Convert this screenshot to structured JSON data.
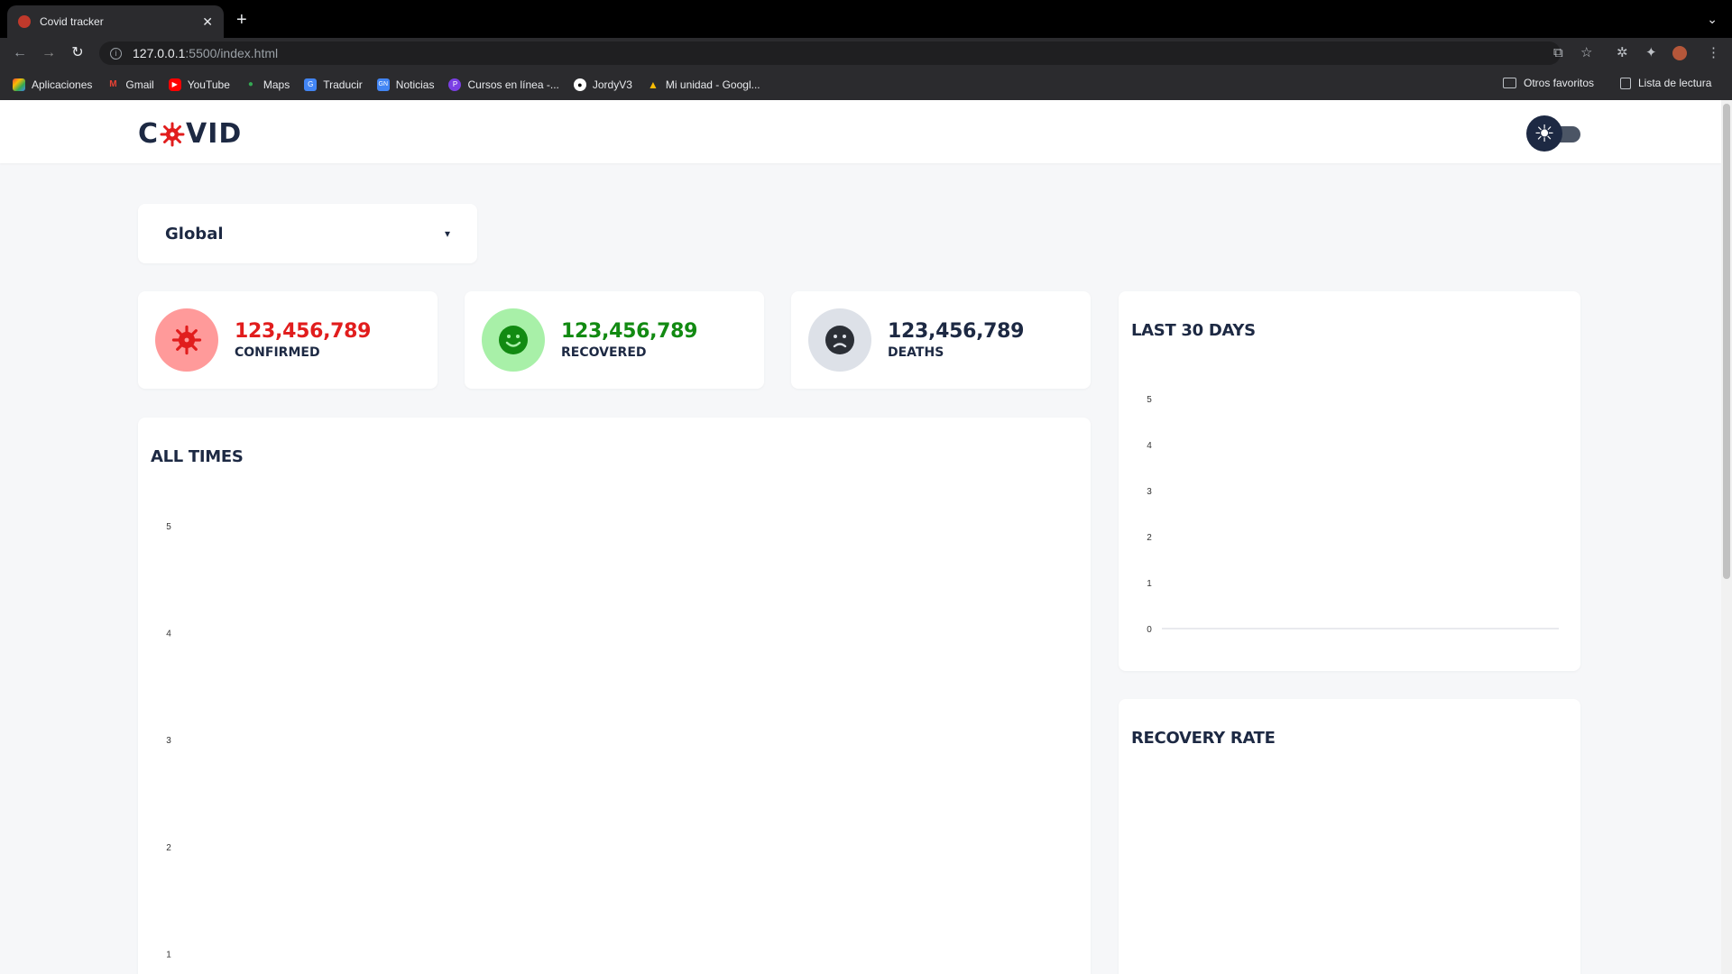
{
  "browser": {
    "tab_title": "Covid tracker",
    "new_tab": "+",
    "url_host": "127.0.0.1",
    "url_path": ":5500/index.html",
    "bookmarks": [
      {
        "label": "Aplicaciones",
        "icon": "apps-grid-icon",
        "color": "#ea4335"
      },
      {
        "label": "Gmail",
        "icon": "gmail-icon",
        "color": "#ea4335"
      },
      {
        "label": "YouTube",
        "icon": "youtube-icon",
        "color": "#ff0000"
      },
      {
        "label": "Maps",
        "icon": "maps-icon",
        "color": "#34a853"
      },
      {
        "label": "Traducir",
        "icon": "translate-icon",
        "color": "#4285f4"
      },
      {
        "label": "Noticias",
        "icon": "news-icon",
        "color": "#4285f4"
      },
      {
        "label": "Cursos en línea -...",
        "icon": "courses-icon",
        "color": "#7b3fe4"
      },
      {
        "label": "JordyV3",
        "icon": "github-icon",
        "color": "#ffffff"
      },
      {
        "label": "Mi unidad - Googl...",
        "icon": "drive-icon",
        "color": "#fbbc04"
      }
    ],
    "other_bookmarks": "Otros favoritos",
    "reading_list": "Lista de lectura"
  },
  "app": {
    "logo_left": "C",
    "logo_right": "VID",
    "logo_icon": "virus-icon",
    "theme_icon": "sun-icon"
  },
  "country_select": {
    "value": "Global"
  },
  "stats": {
    "confirmed": {
      "value": "123,456,789",
      "label": "CONFIRMED",
      "color": "#e11d1d",
      "bg": "#ff9a9a"
    },
    "recovered": {
      "value": "123,456,789",
      "label": "RECOVERED",
      "color": "#128a12",
      "bg": "#a8f0a8"
    },
    "deaths": {
      "value": "123,456,789",
      "label": "DEATHS",
      "color": "#1d2943",
      "bg": "#dde1e8"
    }
  },
  "charts": {
    "all_times_title": "ALL TIMES",
    "last_30_title": "LAST 30 DAYS",
    "recovery_rate_title": "RECOVERY RATE"
  },
  "chart_data": [
    {
      "type": "line",
      "title": "ALL TIMES",
      "x": [],
      "series": [],
      "y_ticks": [
        "5",
        "4",
        "3",
        "2",
        "1"
      ],
      "ylim": [
        0,
        5
      ],
      "grid": false
    },
    {
      "type": "line",
      "title": "LAST 30 DAYS",
      "x": [],
      "series": [],
      "y_ticks": [
        "5",
        "4",
        "3",
        "2",
        "1",
        "0"
      ],
      "ylim": [
        0,
        5
      ],
      "grid": false
    }
  ]
}
